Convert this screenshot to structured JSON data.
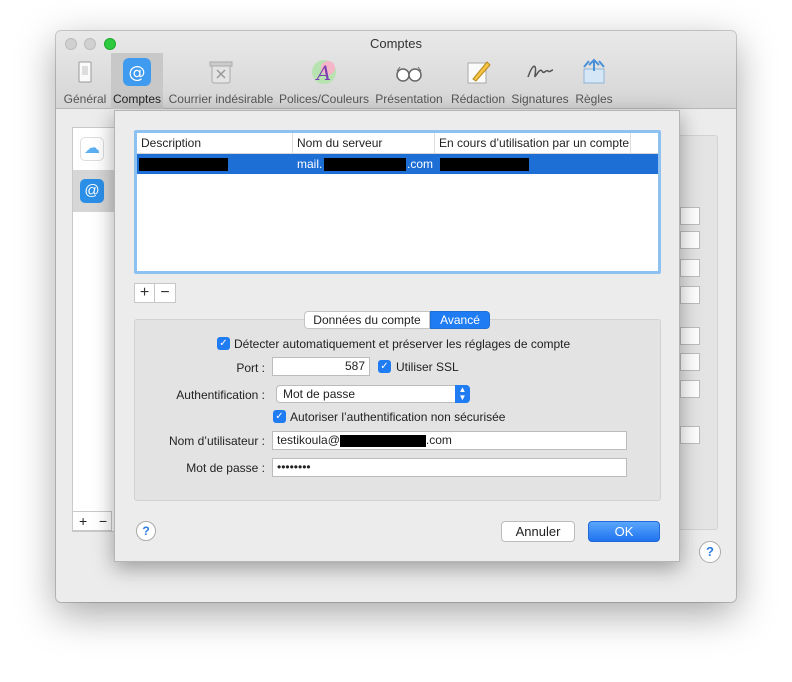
{
  "window": {
    "title": "Comptes",
    "toolbar": [
      {
        "label": "Général",
        "icon": "general-icon"
      },
      {
        "label": "Comptes",
        "icon": "at-icon"
      },
      {
        "label": "Courrier indésirable",
        "icon": "junk-icon"
      },
      {
        "label": "Polices/Couleurs",
        "icon": "fonts-icon"
      },
      {
        "label": "Présentation",
        "icon": "glasses-icon"
      },
      {
        "label": "Rédaction",
        "icon": "pencil-icon"
      },
      {
        "label": "Signatures",
        "icon": "signature-icon"
      },
      {
        "label": "Règles",
        "icon": "rules-icon"
      }
    ],
    "selected_tab": "Comptes"
  },
  "background": {
    "plus": "+",
    "minus": "−",
    "help": "?"
  },
  "sheet": {
    "table": {
      "columns": [
        "Description",
        "Nom du serveur",
        "En cours d’utilisation par un compte"
      ],
      "rows": [
        {
          "server_prefix": "mail.",
          "server_suffix": ".com"
        }
      ]
    },
    "add_label": "+",
    "remove_label": "−",
    "tabs": [
      "Données du compte",
      "Avancé"
    ],
    "selected_tab": "Avancé",
    "auto_detect": {
      "label": "Détecter automatiquement et préserver les réglages de compte",
      "checked": true
    },
    "port": {
      "label": "Port :",
      "value": "587"
    },
    "ssl": {
      "label": "Utiliser SSL",
      "checked": true
    },
    "auth": {
      "label": "Authentification :",
      "value": "Mot de passe"
    },
    "insecure_auth": {
      "label": "Autoriser l’authentification non sécurisée",
      "checked": true
    },
    "username": {
      "label": "Nom d’utilisateur :",
      "prefix": "testikoula@",
      "suffix": ".com"
    },
    "password": {
      "label": "Mot de passe :",
      "value": "••••••••"
    },
    "help": "?",
    "cancel_label": "Annuler",
    "ok_label": "OK"
  },
  "colors": {
    "accent": "#1f7cf2",
    "selection": "#1d6fd6"
  }
}
